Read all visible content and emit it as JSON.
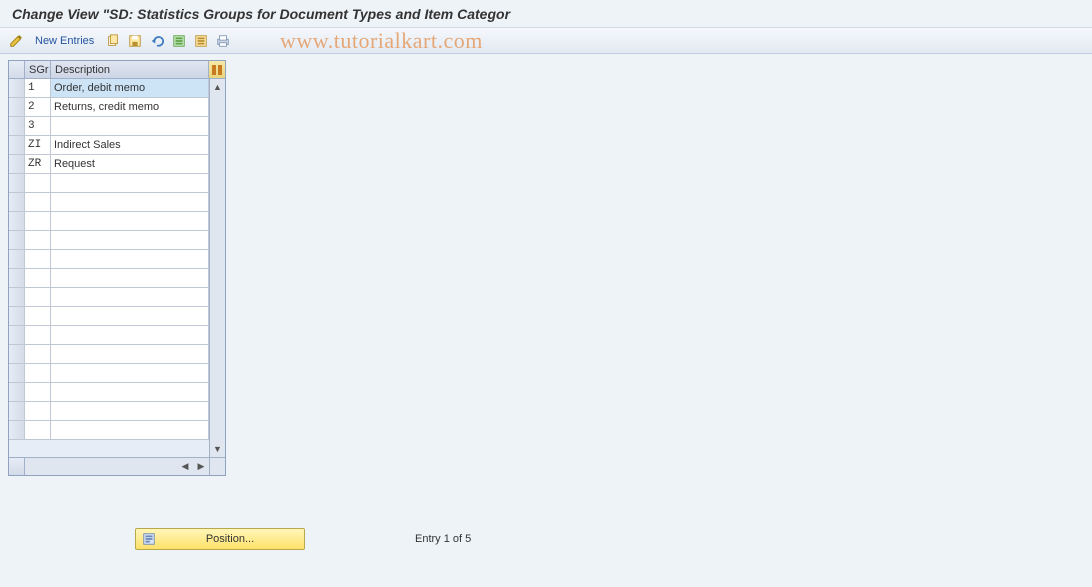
{
  "title": "Change View \"SD: Statistics Groups for Document Types and Item Categor",
  "watermark": "www.tutorialkart.com",
  "toolbar": {
    "new_entries_label": "New Entries"
  },
  "table": {
    "columns": {
      "sgr": "SGr",
      "description": "Description"
    },
    "rows": [
      {
        "sgr": "1",
        "desc": "Order, debit memo",
        "highlighted": true
      },
      {
        "sgr": "2",
        "desc": "Returns, credit memo",
        "highlighted": false
      },
      {
        "sgr": "3",
        "desc": "",
        "highlighted": false
      },
      {
        "sgr": "ZI",
        "desc": "Indirect Sales",
        "highlighted": false
      },
      {
        "sgr": "ZR",
        "desc": "Request",
        "highlighted": false
      },
      {
        "sgr": "",
        "desc": "",
        "highlighted": false
      },
      {
        "sgr": "",
        "desc": "",
        "highlighted": false
      },
      {
        "sgr": "",
        "desc": "",
        "highlighted": false
      },
      {
        "sgr": "",
        "desc": "",
        "highlighted": false
      },
      {
        "sgr": "",
        "desc": "",
        "highlighted": false
      },
      {
        "sgr": "",
        "desc": "",
        "highlighted": false
      },
      {
        "sgr": "",
        "desc": "",
        "highlighted": false
      },
      {
        "sgr": "",
        "desc": "",
        "highlighted": false
      },
      {
        "sgr": "",
        "desc": "",
        "highlighted": false
      },
      {
        "sgr": "",
        "desc": "",
        "highlighted": false
      },
      {
        "sgr": "",
        "desc": "",
        "highlighted": false
      },
      {
        "sgr": "",
        "desc": "",
        "highlighted": false
      },
      {
        "sgr": "",
        "desc": "",
        "highlighted": false
      },
      {
        "sgr": "",
        "desc": "",
        "highlighted": false
      }
    ]
  },
  "footer": {
    "position_label": "Position...",
    "entry_counter": "Entry 1 of 5"
  }
}
